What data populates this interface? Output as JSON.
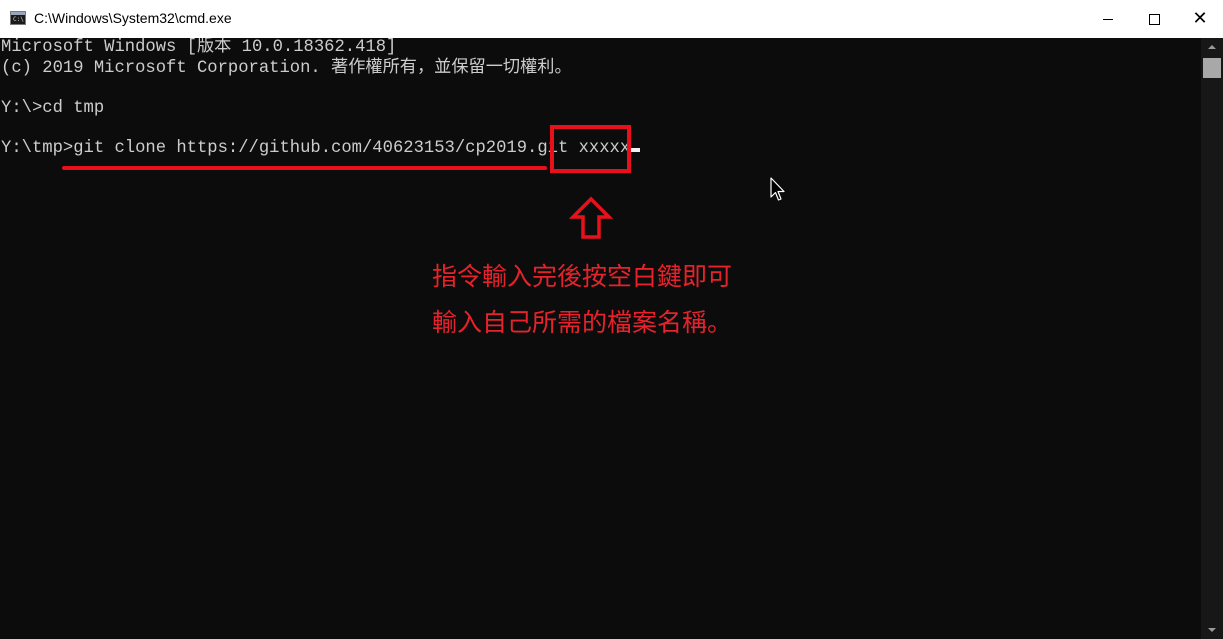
{
  "window": {
    "title": "C:\\Windows\\System32\\cmd.exe",
    "icon": "cmd-icon",
    "controls": [
      "minimize-icon",
      "maximize-icon",
      "close-icon"
    ]
  },
  "console": {
    "lines": [
      "Microsoft Windows [版本 10.0.18362.418]",
      "(c) 2019 Microsoft Corporation. 著作權所有，並保留一切權利。",
      "Y:\\>cd tmp",
      "Y:\\tmp>git clone https://github.com/40623153/cp2019.git xxxxx"
    ]
  },
  "annotation": {
    "line1": "指令輸入完後按空白鍵即可",
    "line2": "輸入自己所需的檔案名稱。",
    "color": "#e8111b",
    "arrow_icon": "up-arrow-icon"
  },
  "colors": {
    "console_bg": "#0c0c0c",
    "console_text": "#cccccc",
    "titlebar_bg": "#ffffff"
  }
}
